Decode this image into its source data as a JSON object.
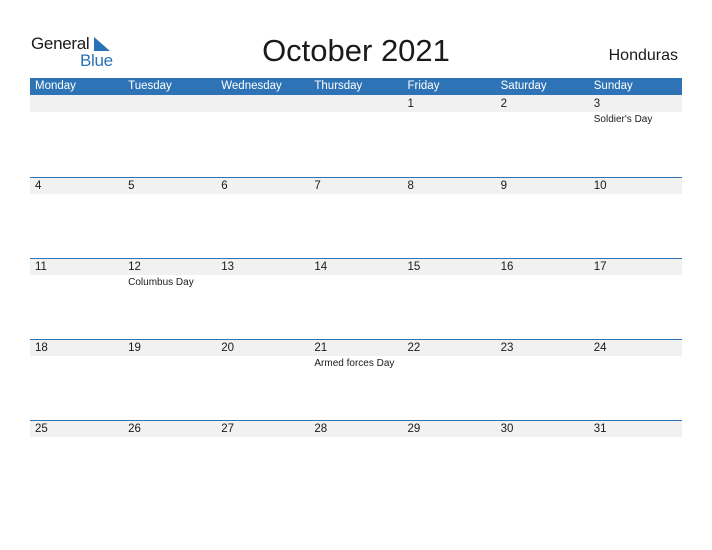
{
  "logo": {
    "part1": "General",
    "part2": "Blue"
  },
  "title": "October 2021",
  "country": "Honduras",
  "weekdays": [
    "Monday",
    "Tuesday",
    "Wednesday",
    "Thursday",
    "Friday",
    "Saturday",
    "Sunday"
  ],
  "weeks": [
    [
      {
        "day": "",
        "holiday": ""
      },
      {
        "day": "",
        "holiday": ""
      },
      {
        "day": "",
        "holiday": ""
      },
      {
        "day": "",
        "holiday": ""
      },
      {
        "day": "1",
        "holiday": ""
      },
      {
        "day": "2",
        "holiday": ""
      },
      {
        "day": "3",
        "holiday": "Soldier's Day"
      }
    ],
    [
      {
        "day": "4",
        "holiday": ""
      },
      {
        "day": "5",
        "holiday": ""
      },
      {
        "day": "6",
        "holiday": ""
      },
      {
        "day": "7",
        "holiday": ""
      },
      {
        "day": "8",
        "holiday": ""
      },
      {
        "day": "9",
        "holiday": ""
      },
      {
        "day": "10",
        "holiday": ""
      }
    ],
    [
      {
        "day": "11",
        "holiday": ""
      },
      {
        "day": "12",
        "holiday": "Columbus Day"
      },
      {
        "day": "13",
        "holiday": ""
      },
      {
        "day": "14",
        "holiday": ""
      },
      {
        "day": "15",
        "holiday": ""
      },
      {
        "day": "16",
        "holiday": ""
      },
      {
        "day": "17",
        "holiday": ""
      }
    ],
    [
      {
        "day": "18",
        "holiday": ""
      },
      {
        "day": "19",
        "holiday": ""
      },
      {
        "day": "20",
        "holiday": ""
      },
      {
        "day": "21",
        "holiday": "Armed forces Day"
      },
      {
        "day": "22",
        "holiday": ""
      },
      {
        "day": "23",
        "holiday": ""
      },
      {
        "day": "24",
        "holiday": ""
      }
    ],
    [
      {
        "day": "25",
        "holiday": ""
      },
      {
        "day": "26",
        "holiday": ""
      },
      {
        "day": "27",
        "holiday": ""
      },
      {
        "day": "28",
        "holiday": ""
      },
      {
        "day": "29",
        "holiday": ""
      },
      {
        "day": "30",
        "holiday": ""
      },
      {
        "day": "31",
        "holiday": ""
      }
    ]
  ],
  "colors": {
    "accent": "#2e73b5",
    "strip": "#f1f1f1"
  }
}
